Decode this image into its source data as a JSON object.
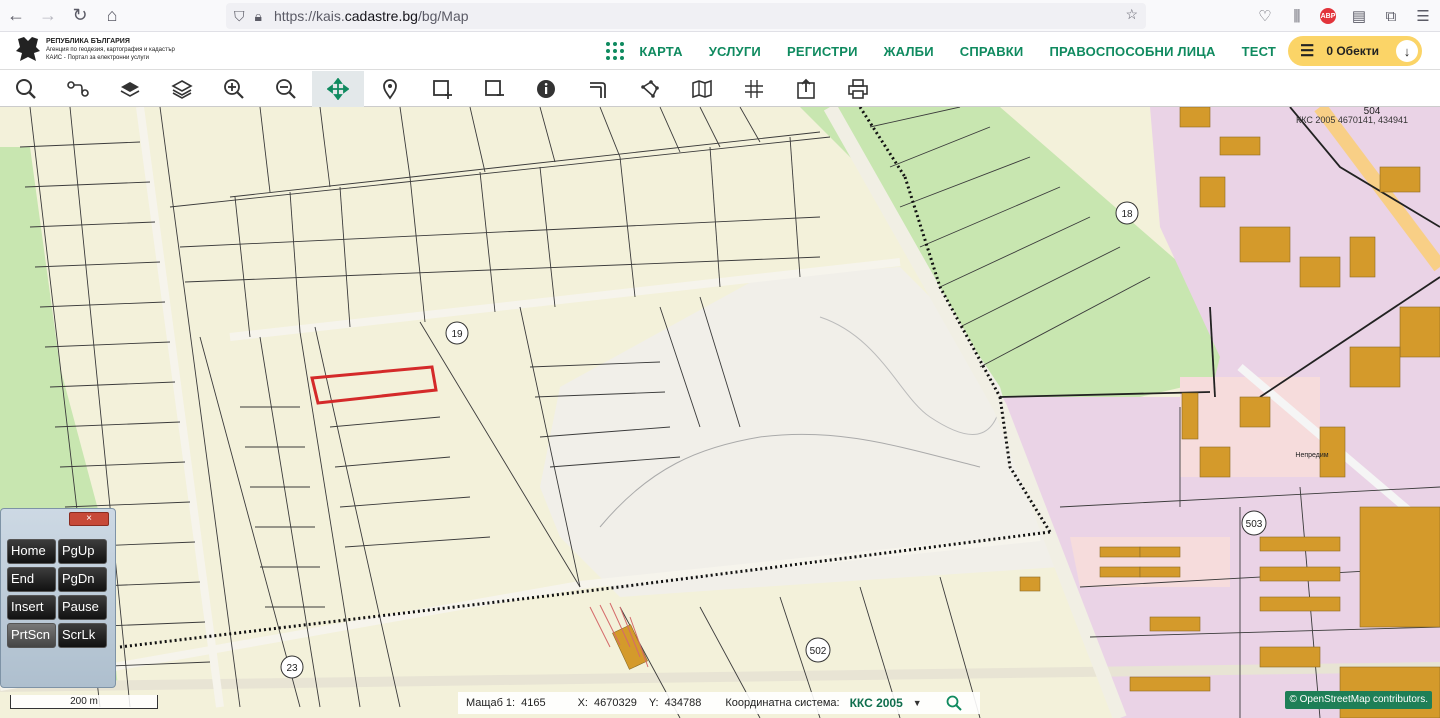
{
  "browser": {
    "url_prefix": "https://kais.",
    "url_host": "cadastre.bg",
    "url_path": "/bg/Map",
    "extension_badge": "ABP"
  },
  "header": {
    "logo": {
      "line1": "РЕПУБЛИКА БЪЛГАРИЯ",
      "line2": "Агенция по геодезия, картография и кадастър",
      "line3": "КАИС - Портал за електронни услуги"
    },
    "nav": [
      "КАРТА",
      "УСЛУГИ",
      "РЕГИСТРИ",
      "ЖАЛБИ",
      "СПРАВКИ",
      "ПРАВОСПОСОБНИ ЛИЦА",
      "ТЕСТ"
    ],
    "cart_label": "0 Обекти"
  },
  "toolbar": {
    "tools": [
      "search-icon",
      "route-icon",
      "layers-icon",
      "layers-stack-icon",
      "zoom-in-icon",
      "zoom-out-icon",
      "pan-icon",
      "marker-icon",
      "select-rect-icon",
      "deselect-rect-icon",
      "info-icon",
      "measure-icon",
      "polygon-icon",
      "map-icon",
      "grid-icon",
      "export-icon",
      "print-icon"
    ],
    "active_tool": "pan-icon",
    "accent_color": "#0f8a5f"
  },
  "map": {
    "colors": {
      "agricultural": "#f3f1da",
      "green": "#c8e6b0",
      "urban": "#ead3e6",
      "road": "#f4f4f0",
      "building": "#d49a2b",
      "highlight": "#d42a2a"
    },
    "region_labels": [
      "19",
      "18",
      "23",
      "502",
      "503",
      "504"
    ],
    "coord_overlay": "ККС 2005 4670141, 434941",
    "street_label": "Непредим"
  },
  "keyboard": {
    "close": "×",
    "keys": [
      "Home",
      "PgUp",
      "End",
      "PgDn",
      "Insert",
      "Pause",
      "PrtScn",
      "ScrLk"
    ],
    "pressed": "PrtScn"
  },
  "scalebar": {
    "label": "200 m"
  },
  "status": {
    "scale_label": "Мащаб 1:",
    "scale_value": "4165",
    "x_label": "X:",
    "x_value": "4670329",
    "y_label": "Y:",
    "y_value": "434788",
    "system_label": "Координатна система:",
    "system_value": "ККС 2005"
  },
  "attribution": "© OpenStreetMap contributors."
}
